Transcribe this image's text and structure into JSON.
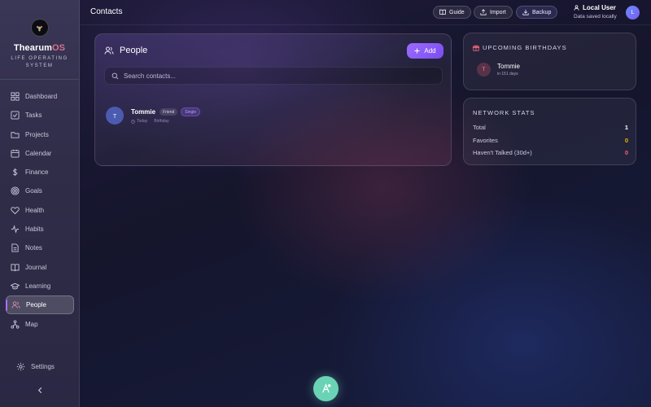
{
  "brand": {
    "name_main": "Thearum",
    "name_accent": "OS",
    "subtitle": "LIFE OPERATING SYSTEM"
  },
  "sidebar": {
    "items": [
      {
        "label": "Dashboard",
        "icon": "grid-icon"
      },
      {
        "label": "Tasks",
        "icon": "checkbox-icon"
      },
      {
        "label": "Projects",
        "icon": "folder-icon"
      },
      {
        "label": "Calendar",
        "icon": "calendar-icon"
      },
      {
        "label": "Finance",
        "icon": "dollar-icon"
      },
      {
        "label": "Goals",
        "icon": "target-icon"
      },
      {
        "label": "Health",
        "icon": "heart-icon"
      },
      {
        "label": "Habits",
        "icon": "activity-icon"
      },
      {
        "label": "Notes",
        "icon": "note-icon"
      },
      {
        "label": "Journal",
        "icon": "book-icon"
      },
      {
        "label": "Learning",
        "icon": "graduation-cap-icon"
      },
      {
        "label": "People",
        "icon": "users-icon",
        "active": true
      },
      {
        "label": "Map",
        "icon": "network-icon"
      }
    ],
    "settings_label": "Settings"
  },
  "header": {
    "title": "Contacts",
    "buttons": {
      "guide": "Guide",
      "import": "Import",
      "backup": "Backup"
    },
    "user": {
      "name": "Local User",
      "status": "Data saved locally",
      "initial": "L"
    }
  },
  "people": {
    "title": "People",
    "add_label": "Add",
    "search_placeholder": "Search contacts...",
    "contacts": [
      {
        "initial": "T",
        "name": "Tommie",
        "relation": "Friend",
        "status": "Single",
        "meta_time": "Today",
        "meta_note": "Birthday"
      }
    ]
  },
  "birthdays": {
    "title": "UPCOMING BIRTHDAYS",
    "items": [
      {
        "initial": "T",
        "name": "Tommie",
        "sub": "in 151 days"
      }
    ]
  },
  "stats": {
    "title": "NETWORK STATS",
    "rows": [
      {
        "label": "Total",
        "value": "1",
        "color": "#ffffff"
      },
      {
        "label": "Favorites",
        "value": "0",
        "color": "#f5b400"
      },
      {
        "label": "Haven't Talked (30d+)",
        "value": "0",
        "color": "#ff5a6a"
      }
    ]
  },
  "colors": {
    "accent": "#8c5cf6",
    "fab": "#6ad3b5",
    "brand_os": "#d9708c"
  }
}
